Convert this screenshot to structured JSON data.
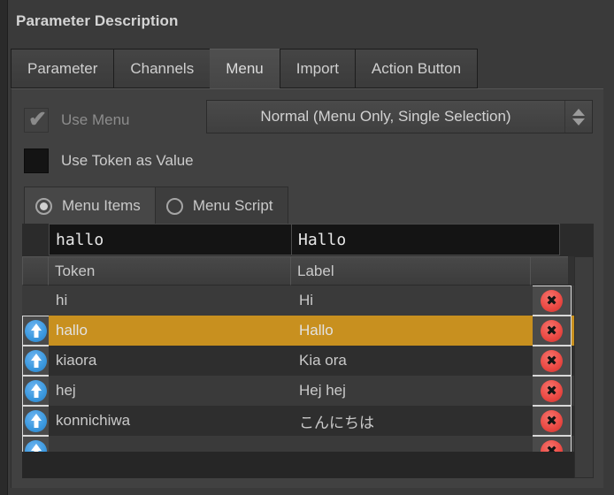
{
  "window": {
    "title": "Parameter Description"
  },
  "tabs": [
    {
      "label": "Parameter",
      "active": false
    },
    {
      "label": "Channels",
      "active": false
    },
    {
      "label": "Menu",
      "active": true
    },
    {
      "label": "Import",
      "active": false
    },
    {
      "label": "Action Button",
      "active": false
    }
  ],
  "options": {
    "use_menu": {
      "label": "Use Menu",
      "checked": true,
      "enabled": false,
      "check_glyph": "✔"
    },
    "menu_mode": {
      "value": "Normal (Menu Only, Single Selection)"
    },
    "use_token_as_value": {
      "label": "Use Token as Value",
      "checked": false
    }
  },
  "mode_tabs": [
    {
      "label": "Menu Items",
      "selected": true
    },
    {
      "label": "Menu Script",
      "selected": false
    }
  ],
  "editor": {
    "token_value": "hallo",
    "label_value": "Hallo"
  },
  "table": {
    "columns": [
      "Token",
      "Label"
    ],
    "rows": [
      {
        "token": "hi",
        "label": "Hi",
        "has_move": false,
        "selected": false
      },
      {
        "token": "hallo",
        "label": "Hallo",
        "has_move": true,
        "selected": true
      },
      {
        "token": "kiaora",
        "label": "Kia ora",
        "has_move": true,
        "selected": false
      },
      {
        "token": "hej",
        "label": "Hej hej",
        "has_move": true,
        "selected": false
      },
      {
        "token": "konnichiwa",
        "label": "こんにちは",
        "has_move": true,
        "selected": false
      },
      {
        "token": "",
        "label": "",
        "has_move": true,
        "selected": false
      }
    ]
  },
  "colors": {
    "selection": "#c8901f",
    "move_button": "#3d9ae0",
    "delete_button": "#ec4b45",
    "panel_bg": "#414141",
    "window_bg": "#3a3a3a"
  }
}
